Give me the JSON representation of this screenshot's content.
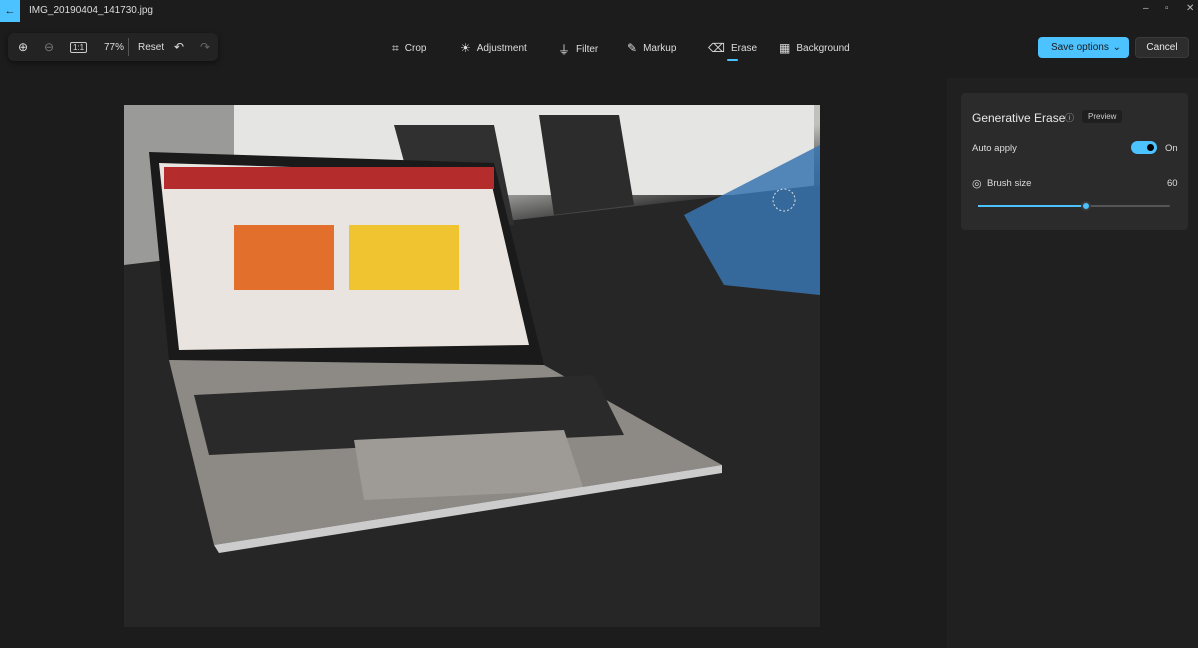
{
  "window": {
    "title": "IMG_20190404_141730.jpg",
    "back_icon": "arrow-left-icon",
    "controls": [
      "minimize-icon",
      "restore-icon",
      "close-icon"
    ]
  },
  "zoom_bar": {
    "zoom_in_icon": "zoom-in-icon",
    "zoom_out_icon": "zoom-out-icon",
    "fit_icon": "actual-size-icon",
    "zoom_level": "77%",
    "reset": "Reset",
    "undo_icon": "undo-icon",
    "redo_icon": "redo-icon"
  },
  "tools": [
    {
      "label": "Crop",
      "icon": "crop-icon"
    },
    {
      "label": "Adjustment",
      "icon": "brightness-icon"
    },
    {
      "label": "Filter",
      "icon": "filter-icon"
    },
    {
      "label": "Markup",
      "icon": "pen-icon"
    },
    {
      "label": "Erase",
      "icon": "eraser-icon",
      "active": true
    },
    {
      "label": "Background",
      "icon": "background-icon"
    }
  ],
  "actions": {
    "save": "Save options",
    "cancel": "Cancel"
  },
  "panel": {
    "title": "Generative Erase",
    "badge": "Preview",
    "auto_apply_label": "Auto apply",
    "auto_apply_state": "On",
    "brush_size_label": "Brush size",
    "brush_size_value": "60",
    "brush_slider_fraction": 0.56
  },
  "colors": {
    "accent": "#4cc2ff",
    "background": "#1c1c1c",
    "panel": "#2b2b2b"
  }
}
